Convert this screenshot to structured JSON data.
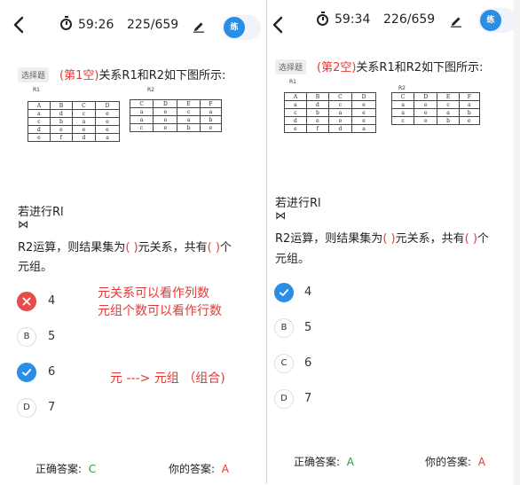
{
  "left": {
    "header": {
      "timer": "59:26",
      "progress": "225/659",
      "practice_label": "练"
    },
    "badge": "选择题",
    "question": {
      "blank": "(第1空)",
      "text": "关系R1和R2如下图所示:"
    },
    "r1_label": "R1",
    "r2_label": "R2",
    "r1": {
      "headers": [
        "A",
        "B",
        "C",
        "D"
      ],
      "rows": [
        [
          "a",
          "d",
          "c",
          "e"
        ],
        [
          "c",
          "b",
          "a",
          "e"
        ],
        [
          "d",
          "e",
          "e",
          "e"
        ],
        [
          "e",
          "f",
          "d",
          "a"
        ]
      ]
    },
    "r2": {
      "headers": [
        "C",
        "D",
        "E",
        "F"
      ],
      "rows": [
        [
          "a",
          "e",
          "c",
          "a"
        ],
        [
          "a",
          "e",
          "a",
          "b"
        ],
        [
          "c",
          "e",
          "b",
          "e"
        ]
      ]
    },
    "body": {
      "line1": "若进行Rl",
      "join": "⋈",
      "line3_a": "R2运算，则结果集为",
      "paren1": "( )",
      "line3_b": "元关系，共有",
      "paren2": "( )",
      "line3_c": "个",
      "line4": "元组。"
    },
    "options": [
      {
        "letter": "",
        "text": "4",
        "state": "wrong"
      },
      {
        "letter": "B",
        "text": "5",
        "state": "none"
      },
      {
        "letter": "",
        "text": "6",
        "state": "correct"
      },
      {
        "letter": "D",
        "text": "7",
        "state": "none"
      }
    ],
    "annotations": {
      "note1": "元关系可以看作列数",
      "note2": "元组个数可以看作行数",
      "note3": "元 ---> 元组  （组合)"
    },
    "footer": {
      "correct_label": "正确答案:",
      "correct_value": "C",
      "your_label": "你的答案:",
      "your_value": "A"
    }
  },
  "right": {
    "header": {
      "timer": "59:34",
      "progress": "226/659",
      "practice_label": "练"
    },
    "badge": "选择题",
    "question": {
      "blank": "(第2空)",
      "text": "关系R1和R2如下图所示:"
    },
    "r1_label": "R1",
    "r2_label": "R2",
    "r1": {
      "headers": [
        "A",
        "B",
        "C",
        "D"
      ],
      "rows": [
        [
          "a",
          "d",
          "c",
          "e"
        ],
        [
          "c",
          "b",
          "a",
          "e"
        ],
        [
          "d",
          "e",
          "e",
          "e"
        ],
        [
          "e",
          "f",
          "d",
          "a"
        ]
      ]
    },
    "r2": {
      "headers": [
        "C",
        "D",
        "E",
        "F"
      ],
      "rows": [
        [
          "a",
          "e",
          "c",
          "a"
        ],
        [
          "a",
          "e",
          "a",
          "b"
        ],
        [
          "c",
          "e",
          "b",
          "e"
        ]
      ]
    },
    "body": {
      "line1": "若进行Rl",
      "join": "⋈",
      "line3_a": "R2运算，则结果集为",
      "paren1": "( )",
      "line3_b": "元关系，共有",
      "paren2": "( )",
      "line3_c": "个",
      "line4": "元组。"
    },
    "options": [
      {
        "letter": "",
        "text": "4",
        "state": "correct"
      },
      {
        "letter": "B",
        "text": "5",
        "state": "none"
      },
      {
        "letter": "C",
        "text": "6",
        "state": "none"
      },
      {
        "letter": "D",
        "text": "7",
        "state": "none"
      }
    ],
    "footer": {
      "correct_label": "正确答案:",
      "correct_value": "A",
      "your_label": "你的答案:",
      "your_value": "A"
    }
  },
  "colors": {
    "accent": "#2a8ee6",
    "wrong": "#e74c4c",
    "correct_text": "#2e9d3a",
    "red_text": "#e53935"
  }
}
